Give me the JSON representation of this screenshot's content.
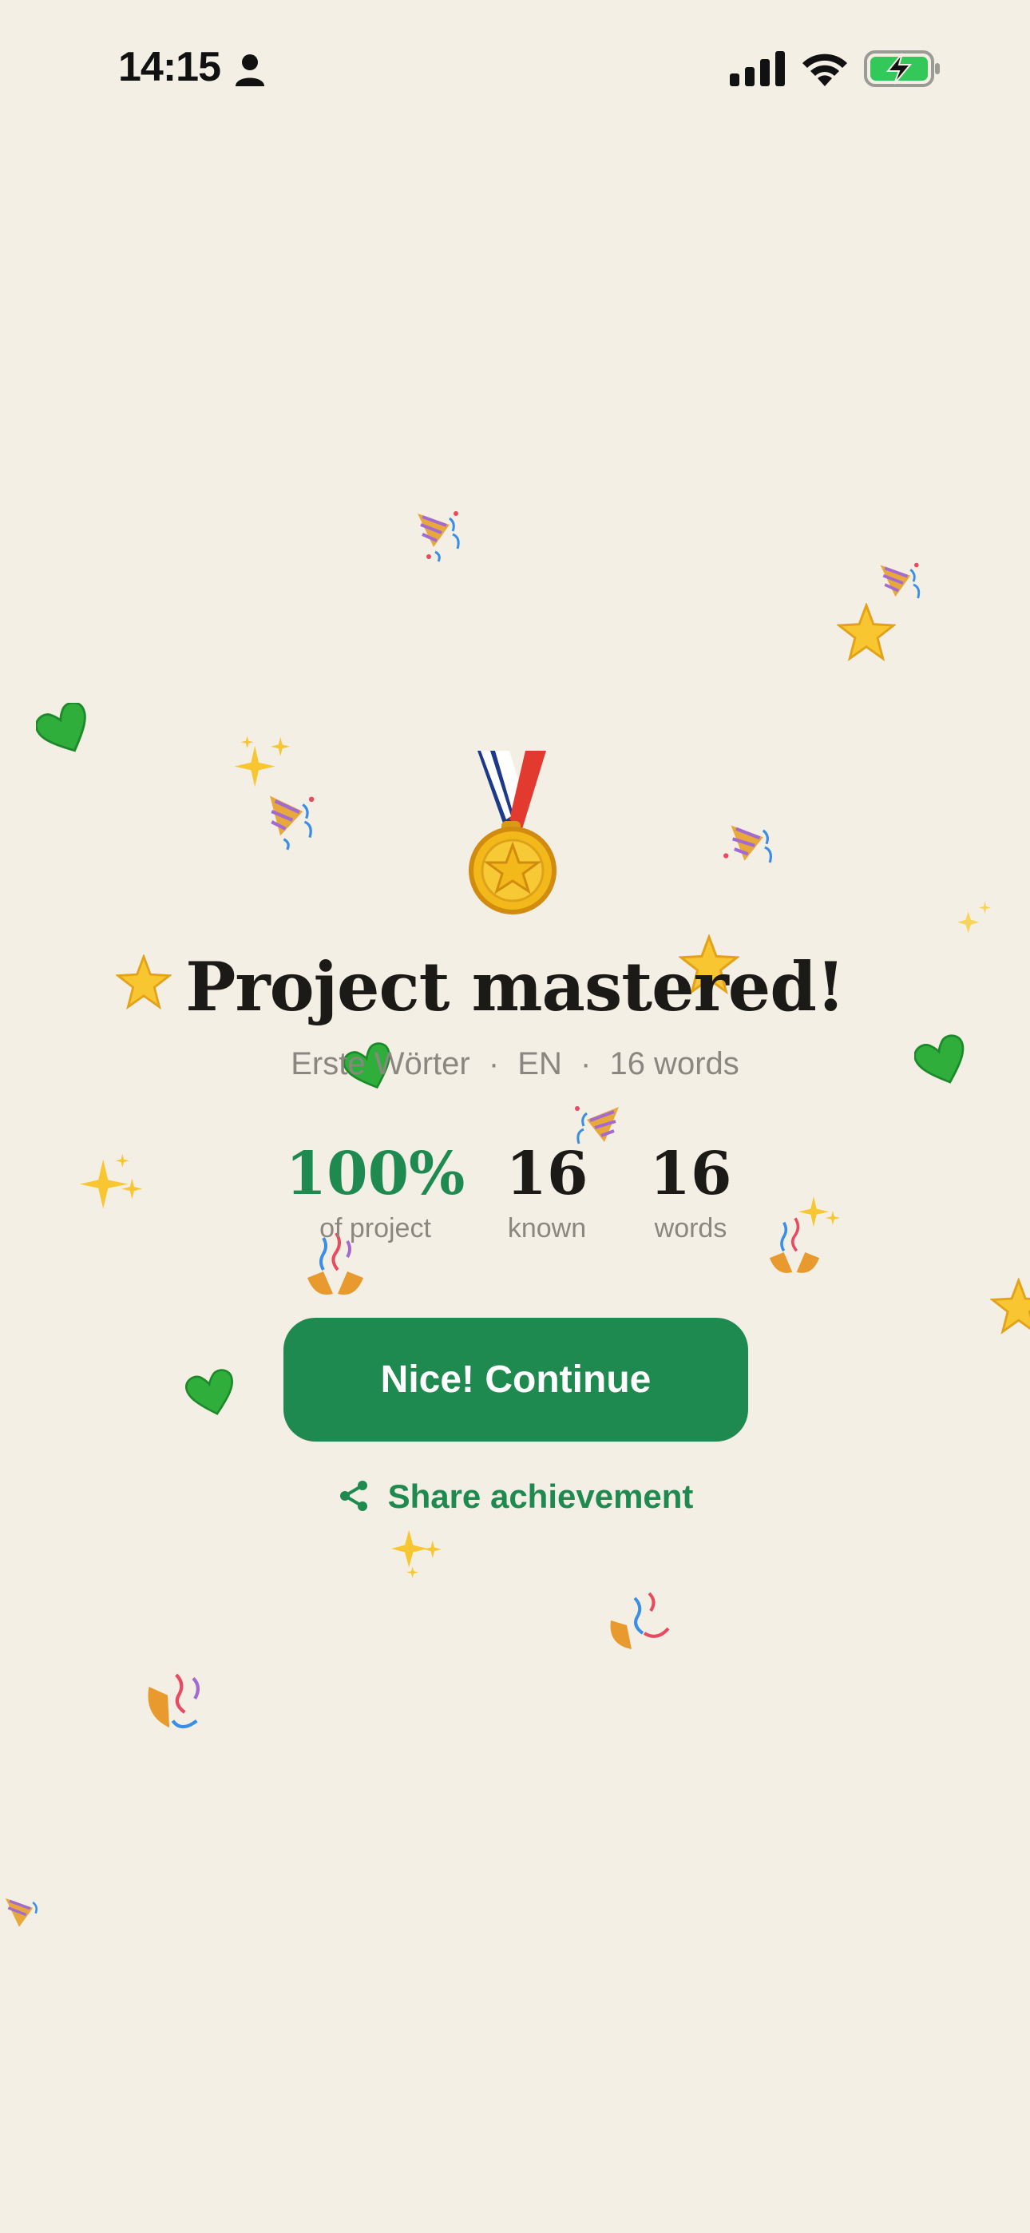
{
  "status_bar": {
    "time": "14:15",
    "icons": [
      "person-icon",
      "cellular-signal-icon",
      "wifi-icon",
      "battery-charging-icon"
    ],
    "battery_color": "#34c759"
  },
  "celebration": {
    "medal_icon": "gold-medal-icon",
    "title": "Project mastered!",
    "subtitle_parts": [
      "Erste Wörter",
      "·",
      "EN",
      "·",
      "16 words"
    ],
    "stats": [
      {
        "value": "100%",
        "label": "of project"
      },
      {
        "value": "16",
        "label": "known"
      },
      {
        "value": "16",
        "label": "words"
      }
    ],
    "primary_button": "Nice! Continue",
    "share_label": "Share achievement",
    "share_icon": "share-icon"
  },
  "confetti_icons": [
    "party-popper-icon",
    "star-icon",
    "green-heart-icon",
    "sparkles-icon",
    "confetti-icon"
  ],
  "colors": {
    "background": "#f3efe5",
    "accent": "#1f8a4f",
    "text": "#1c1a17",
    "muted": "#8b8780"
  }
}
